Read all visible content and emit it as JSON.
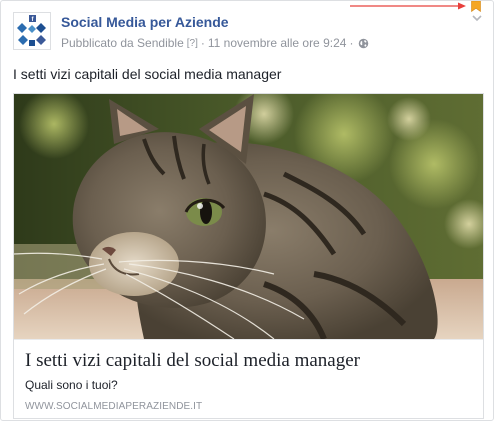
{
  "post": {
    "page_name": "Social Media per Aziende",
    "published_by": "Pubblicato da Sendible",
    "help_marker": "[?]",
    "separator": "·",
    "timestamp": "11 novembre alle ore 9:24",
    "audience_icon": "globe-icon",
    "text": "I setti vizi capitali del social media manager"
  },
  "link_preview": {
    "image_icon": "cat-photo",
    "title": "I setti vizi capitali del social media manager",
    "description": "Quali sono i tuoi?",
    "domain": "WWW.SOCIALMEDIAPERAZIENDE.IT"
  },
  "colors": {
    "page_name": "#365899",
    "meta": "#90949c",
    "text": "#1d2129",
    "border": "#dddfe2",
    "annotation_arrow": "#e8403c",
    "bookmark": "#f5a623"
  },
  "icons": {
    "bookmark": "bookmark-icon",
    "options": "chevron-down-icon",
    "annotation": "arrow-icon",
    "avatar": "avatar-logo-icon"
  }
}
